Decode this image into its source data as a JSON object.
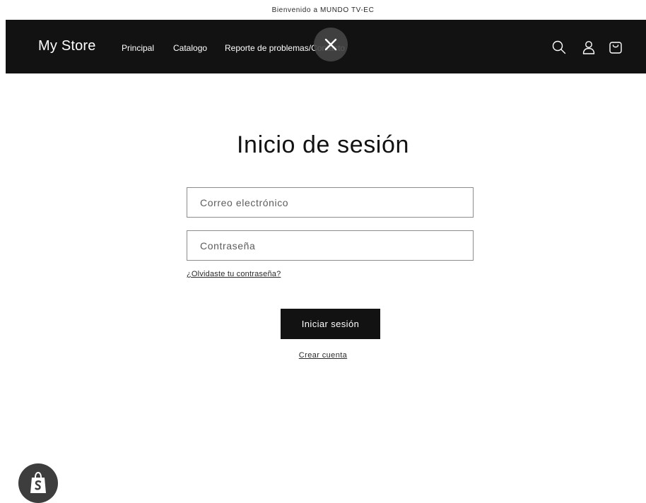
{
  "announcement": {
    "text": "Bienvenido a MUNDO TV-EC"
  },
  "header": {
    "logo": "My Store",
    "nav": [
      {
        "label": "Principal"
      },
      {
        "label": "Catalogo"
      },
      {
        "label": "Reporte de problemas/Contacto"
      }
    ],
    "icons": [
      "search-icon",
      "account-icon",
      "cart-icon"
    ]
  },
  "login": {
    "title": "Inicio de sesión",
    "email": {
      "placeholder": "Correo electrónico",
      "value": ""
    },
    "password": {
      "placeholder": "Contraseña",
      "value": ""
    },
    "forgot_link": "¿Olvidaste tu contraseña?",
    "submit_label": "Iniciar sesión",
    "create_link": "Crear cuenta"
  },
  "overlay": {
    "icon": "close-icon"
  },
  "badge": {
    "icon": "shopify-bag-icon"
  },
  "colors": {
    "header_bg": "#121212",
    "text": "#121212",
    "background": "#ffffff"
  }
}
